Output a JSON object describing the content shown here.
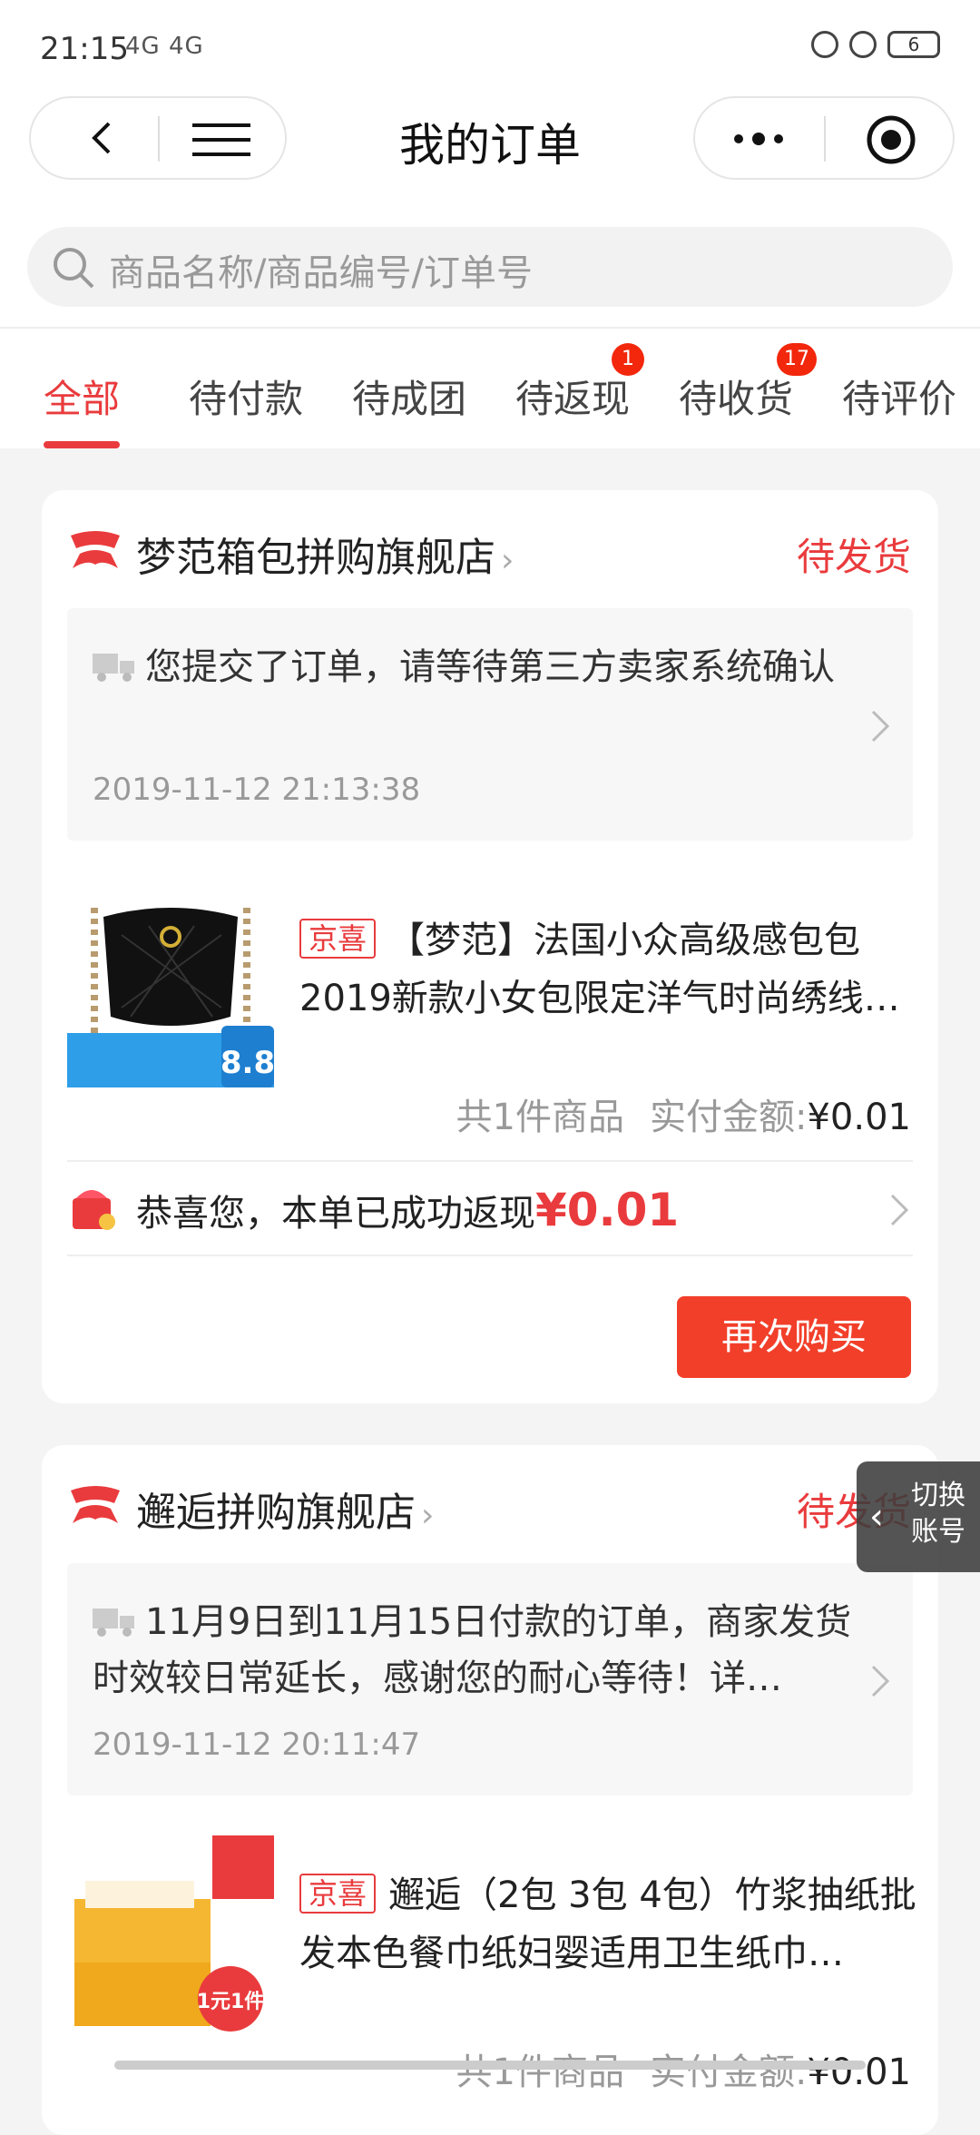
{
  "status_bar": {
    "time": "21:15",
    "network": "4G 4G",
    "battery": "6"
  },
  "nav": {
    "title": "我的订单"
  },
  "search": {
    "placeholder": "商品名称/商品编号/订单号"
  },
  "tabs": [
    {
      "label": "全部",
      "badge": ""
    },
    {
      "label": "待付款",
      "badge": ""
    },
    {
      "label": "待成团",
      "badge": ""
    },
    {
      "label": "待返现",
      "badge": "1"
    },
    {
      "label": "待收货",
      "badge": "17"
    },
    {
      "label": "待评价",
      "badge": ""
    }
  ],
  "orders": [
    {
      "shop": "梦范箱包拼购旗舰店",
      "status": "待发货",
      "notice": "您提交了订单，请等待第三方卖家系统确认",
      "notice_time": "2019-11-12 21:13:38",
      "product_tag": "京喜",
      "product_title": "【梦范】法国小众高级感包包2019新款小女包限定洋气时尚绣线…",
      "product_image_text": "8.8",
      "count": "共1件商品",
      "amount_label": "实付金额:",
      "amount": "¥0.01",
      "cashback_text": "恭喜您，本单已成功返现",
      "cashback_amount": "¥0.01",
      "buy_again": "再次购买"
    },
    {
      "shop": "邂逅拼购旗舰店",
      "status": "待发货",
      "notice": "11月9日到11月15日付款的订单，商家发货时效较日常延长，感谢您的耐心等待！详…",
      "notice_time": "2019-11-12 20:11:47",
      "product_tag": "京喜",
      "product_title": "邂逅（2包 3包 4包）竹浆抽纸批发本色餐巾纸妇婴适用卫生纸巾…",
      "product_image_text": "1元1件",
      "count": "共1件商品",
      "amount_label": "实付金额:",
      "amount": "¥0.01"
    }
  ],
  "float_button": {
    "line1": "切换",
    "line2": "账号"
  },
  "colors": {
    "accent": "#e93b3d",
    "button": "#f23f2a"
  }
}
